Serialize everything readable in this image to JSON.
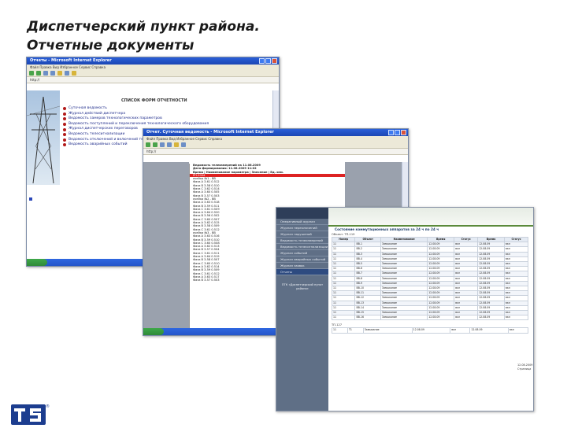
{
  "slide": {
    "title_line1": "Диспетчерский пункт района.",
    "title_line2": "Отчетные документы"
  },
  "window1": {
    "title": "Отчеты - Microsoft Internet Explorer",
    "menu": "Файл  Правка  Вид  Избранное  Сервис  Справка",
    "address": "http://",
    "heading": "СПИСОК ФОРМ ОТЧЕТНОСТИ",
    "items": [
      "Суточная ведомость",
      "Журнал действий диспетчера",
      "Ведомость замеров технологических параметров",
      "Ведомость поступлений и переключения технологического оборудования",
      "Журнал диспетчерских переговоров",
      "Ведомость телесигнализации",
      "Ведомость отключений и включений технологического оборудования",
      "Ведомость аварийных событий"
    ]
  },
  "window2": {
    "title": "Отчет. Суточная ведомость - Microsoft Internet Explorer",
    "lines": [
      "Ведомость телеизмерений на 11.08.2009",
      "Дата формирования: 11.08.2009 11:02",
      "Время | Наименование параметра | Значение | Ед. изм.",
      "РП-2004",
      "ячейка №1 - ВВ",
      "Фаза А  3.61  0.512",
      "Фаза В  3.58  0.510",
      "Фаза С  3.62  0.514",
      "Фаза А  3.60  0.505",
      "Фаза В  3.57  0.503",
      "ячейка №2 - ВВ",
      "Фаза А  3.63  0.518",
      "Фаза В  3.59  0.511",
      "Фаза С  3.61  0.509",
      "Фаза А  3.64  0.520",
      "Фаза В  3.56  0.502",
      "Фаза С  3.60  0.507",
      "Фаза А  3.62  0.515",
      "Фаза В  3.58  0.509",
      "Фаза С  3.61  0.512",
      "ячейка №3 - ВВ",
      "Фаза А  3.63  0.516",
      "Фаза В  3.59  0.510",
      "Фаза С  3.60  0.508",
      "Фаза А  3.62  0.513",
      "Фаза В  3.57  0.504",
      "Фаза С  3.61  0.511",
      "Фаза А  3.64  0.519",
      "Фаза В  3.58  0.507",
      "Фаза С  3.60  0.510",
      "Фаза А  3.62  0.514",
      "Фаза В  3.59  0.509",
      "Фаза С  3.61  0.512",
      "Фаза А  3.63  0.517",
      "Фаза В  3.57  0.503"
    ]
  },
  "window3": {
    "nav_items": [
      "Оперативный журнал",
      "Журнал переключений",
      "Журнал нарушений",
      "Ведомость телеизмерений",
      "Ведомость телесигнализации",
      "Журнал событий",
      "Журнал аварийных событий",
      "Журнал заявок",
      "Отчеты"
    ],
    "nav_note": "ПТК «Диспетчерский пункт района»",
    "heading": "Состояние коммутационных аппаратов за 24 ч по 24 ч",
    "subheading": "Объект: ТП-119",
    "columns": [
      "Номер",
      "Объект",
      "Наименование",
      "Время",
      "Статус",
      "Время",
      "Статус"
    ],
    "rows": [
      [
        "11",
        "ВВ-1",
        "Замыкание",
        "12.08.09",
        "вкл",
        "12.08.09",
        "вкл"
      ],
      [
        "11",
        "ВВ-2",
        "Замыкание",
        "12.08.09",
        "вкл",
        "12.08.09",
        "вкл"
      ],
      [
        "11",
        "ВВ-3",
        "Замыкание",
        "12.08.09",
        "вкл",
        "12.08.09",
        "вкл"
      ],
      [
        "11",
        "ВВ-4",
        "Замыкание",
        "12.08.09",
        "вкл",
        "12.08.09",
        "вкл"
      ],
      [
        "11",
        "ВВ-5",
        "Замыкание",
        "12.08.09",
        "вкл",
        "12.08.09",
        "вкл"
      ],
      [
        "11",
        "ВВ-6",
        "Замыкание",
        "12.08.09",
        "вкл",
        "12.08.09",
        "вкл"
      ],
      [
        "11",
        "ВВ-7",
        "Замыкание",
        "12.08.09",
        "вкл",
        "12.08.09",
        "вкл"
      ],
      [
        "11",
        "ВВ-8",
        "Замыкание",
        "12.08.09",
        "вкл",
        "12.08.09",
        "вкл"
      ],
      [
        "11",
        "ВВ-9",
        "Замыкание",
        "12.08.09",
        "вкл",
        "12.08.09",
        "вкл"
      ],
      [
        "11",
        "ВВ-10",
        "Замыкание",
        "12.08.09",
        "вкл",
        "12.08.09",
        "вкл"
      ],
      [
        "11",
        "ВВ-11",
        "Замыкание",
        "12.08.09",
        "вкл",
        "12.08.09",
        "вкл"
      ],
      [
        "11",
        "ВВ-12",
        "Замыкание",
        "12.08.09",
        "вкл",
        "12.08.09",
        "вкл"
      ],
      [
        "11",
        "ВВ-13",
        "Замыкание",
        "12.08.09",
        "вкл",
        "12.08.09",
        "вкл"
      ],
      [
        "11",
        "ВВ-14",
        "Замыкание",
        "12.08.09",
        "вкл",
        "12.08.09",
        "вкл"
      ],
      [
        "11",
        "ВВ-15",
        "Замыкание",
        "12.08.09",
        "вкл",
        "12.08.09",
        "вкл"
      ],
      [
        "11",
        "ВВ-16",
        "Замыкание",
        "12.08.09",
        "вкл",
        "12.08.09",
        "вкл"
      ]
    ],
    "subheading2": "ТП-127",
    "rows2": [
      [
        "11",
        "Т1",
        "Замыкание",
        "12.08.09",
        "вкл",
        "12.08.09",
        "вкл"
      ]
    ],
    "footer": "12.08.2009  Страница"
  },
  "logo": {
    "text": "TS",
    "mark": "®"
  }
}
